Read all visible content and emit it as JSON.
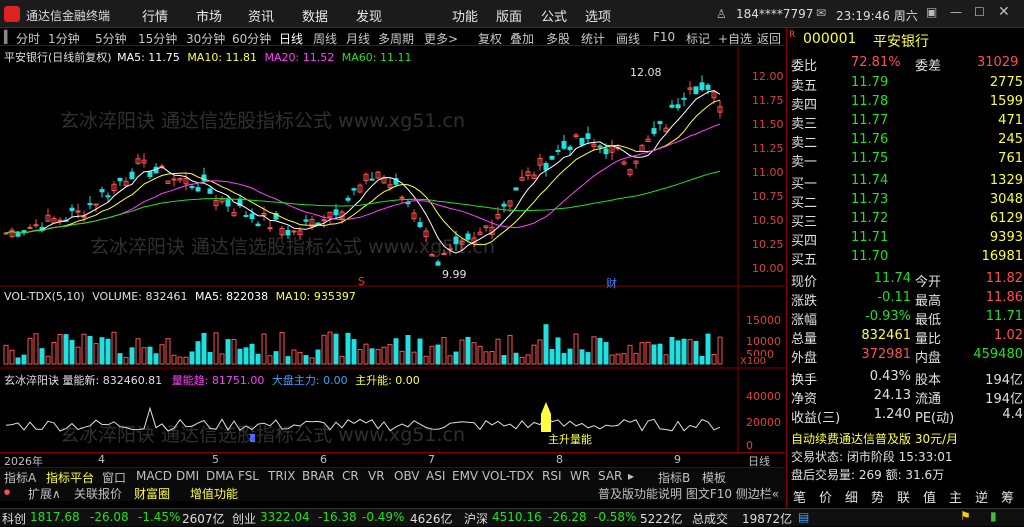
{
  "titlebar": {
    "app_title": "通达信金融终端",
    "menus": [
      "行情",
      "市场",
      "资讯",
      "数据",
      "发现",
      "功能",
      "版面",
      "公式",
      "选项"
    ],
    "account": "184****7797",
    "clock": "23:19:46 周六"
  },
  "period_bar": {
    "items": [
      "分时",
      "1分钟",
      "5分钟",
      "15分钟",
      "30分钟",
      "60分钟",
      "日线",
      "周线",
      "月线",
      "多周期",
      "更多>"
    ],
    "active": "日线",
    "tools": [
      "复权",
      "叠加",
      "多股",
      "统计",
      "画线",
      "F10",
      "标记",
      "+自选",
      "返回"
    ]
  },
  "main_chart": {
    "header": "平安银行(日线前复权)",
    "ma5": "MA5: 11.75",
    "ma10": "MA10: 11.81",
    "ma20": "MA20: 11.52",
    "ma60": "MA60: 11.11",
    "y_ticks": [
      "12.00",
      "11.75",
      "11.50",
      "11.25",
      "11.00",
      "10.75",
      "10.50",
      "10.25",
      "10.00"
    ],
    "high_label": "12.08",
    "low_label": "9.99",
    "marker_s": "S",
    "marker_cai": "财"
  },
  "volume_chart": {
    "header": "VOL-TDX(5,10)",
    "volume": "VOLUME: 832461",
    "ma5": "MA5: 822038",
    "ma10": "MA10: 935397",
    "y_ticks": [
      "15000",
      "10000",
      "5000"
    ],
    "unit": "X100"
  },
  "indicator_chart": {
    "header": "玄冰淬阳诀 量能新: 832460.81",
    "text2": "量能趋: 81751.00",
    "text3": "大盘主力: 0.00",
    "text4": "主升能: 0.00",
    "y_ticks": [
      "40000",
      "20000",
      "0"
    ],
    "label": "主升量能"
  },
  "date_axis": {
    "year": "2026年",
    "months": [
      "4",
      "5",
      "6",
      "7",
      "8",
      "9"
    ],
    "period": "日线"
  },
  "bottom_tabs": [
    "指标A",
    "指标平台",
    "窗口",
    "MACD",
    "DMI",
    "DMA",
    "FSL",
    "TRIX",
    "BRAR",
    "CR",
    "VR",
    "OBV",
    "ASI",
    "EMV",
    "VOL-TDX",
    "RSI",
    "WR",
    "SAR",
    "▸",
    "指标B",
    "模板"
  ],
  "bottom_tabs2": [
    "扩展∧",
    "关联报价",
    "财富圈",
    "增值功能"
  ],
  "bottom_right": "普及版功能说明 图文F10 侧边栏«",
  "quote": {
    "code": "000001",
    "name": "平安银行",
    "weibi_label": "委比",
    "weibi": "72.81%",
    "weicha_label": "委差",
    "weicha": "31029",
    "asks": [
      {
        "label": "卖五",
        "price": "11.79",
        "vol": "2775"
      },
      {
        "label": "卖四",
        "price": "11.78",
        "vol": "1599"
      },
      {
        "label": "卖三",
        "price": "11.77",
        "vol": "471"
      },
      {
        "label": "卖二",
        "price": "11.76",
        "vol": "245"
      },
      {
        "label": "卖一",
        "price": "11.75",
        "vol": "761"
      }
    ],
    "bids": [
      {
        "label": "买一",
        "price": "11.74",
        "vol": "1329"
      },
      {
        "label": "买二",
        "price": "11.73",
        "vol": "3048"
      },
      {
        "label": "买三",
        "price": "11.72",
        "vol": "6129"
      },
      {
        "label": "买四",
        "price": "11.71",
        "vol": "9393"
      },
      {
        "label": "买五",
        "price": "11.70",
        "vol": "16981"
      }
    ],
    "stats": [
      {
        "l1": "现价",
        "v1": "11.74",
        "l2": "今开",
        "v2": "11.82"
      },
      {
        "l1": "涨跌",
        "v1": "-0.11",
        "l2": "最高",
        "v2": "11.86"
      },
      {
        "l1": "涨幅",
        "v1": "-0.93%",
        "l2": "最低",
        "v2": "11.71"
      },
      {
        "l1": "总量",
        "v1": "832461",
        "l2": "量比",
        "v2": "1.02"
      },
      {
        "l1": "外盘",
        "v1": "372981",
        "l2": "内盘",
        "v2": "459480"
      }
    ],
    "stats2": [
      {
        "l1": "换手",
        "v1": "0.43%",
        "l2": "股本",
        "v2": "194亿"
      },
      {
        "l1": "净资",
        "v1": "24.13",
        "l2": "流通",
        "v2": "194亿"
      },
      {
        "l1": "收益(三)",
        "v1": "1.240",
        "l2": "PE(动)",
        "v2": "4.4"
      }
    ],
    "promo": "自动续费通达信普及版 30元/月",
    "trade_status": "交易状态: 闭市阶段 15:33:01",
    "after_hours": "盘后交易量: 269  额: 31.6万",
    "bottom_btns": [
      "笔",
      "价",
      "细",
      "势",
      "联",
      "值",
      "主",
      "逆",
      "筹"
    ]
  },
  "statusbar": [
    {
      "name": "科创",
      "value": "1817.68",
      "chg": "-26.08",
      "pct": "-1.45%",
      "amt": "2607亿"
    },
    {
      "name": "创业",
      "value": "3322.04",
      "chg": "-16.38",
      "pct": "-0.49%",
      "amt": "4626亿"
    },
    {
      "name": "沪深",
      "value": "4510.16",
      "chg": "-26.28",
      "pct": "-0.58%",
      "amt": "5222亿"
    },
    {
      "name": "总成交",
      "value": "19872亿",
      "chg": "",
      "pct": "",
      "amt": ""
    }
  ],
  "watermark": "玄冰淬阳诀 通达信选股指标公式 www.xg51.cn",
  "colors": {
    "up": "#ff5050",
    "down": "#20e0e0",
    "ma5": "#ffffff",
    "ma10": "#ffff40",
    "ma20": "#ff40ff",
    "ma60": "#20e020"
  }
}
